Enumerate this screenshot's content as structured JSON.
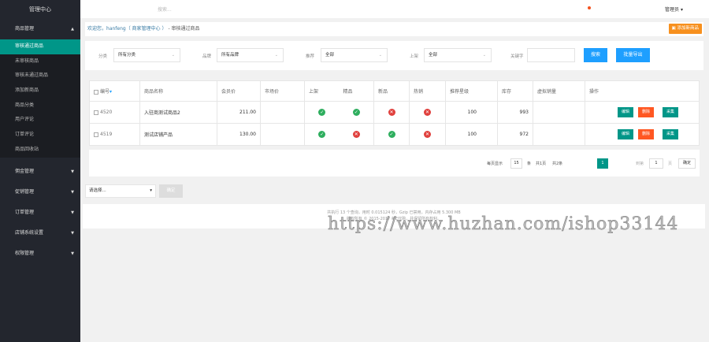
{
  "sidebar": {
    "title": "管理中心",
    "groups": [
      {
        "label": "商品管理",
        "items": [
          "审核通过商品",
          "未审核商品",
          "审核未通过商品",
          "添加新商品",
          "商品分类",
          "用户评论",
          "订单评论",
          "商品回收站"
        ]
      },
      {
        "label": "佣金管理"
      },
      {
        "label": "促销管理"
      },
      {
        "label": "订单管理"
      },
      {
        "label": "店铺系统设置"
      },
      {
        "label": "权限管理"
      }
    ]
  },
  "header": {
    "search_placeholder": "搜索...",
    "user": "管理员"
  },
  "breadcrumb": {
    "welcome": "欢迎您，",
    "user": "hanfeng",
    "center": "（ 商家管理中心 ）",
    "current": " - 审核通过商品",
    "add_button": "添加新商品"
  },
  "filters": {
    "category_label": "分类",
    "category": "所有分类",
    "brand_label": "品牌",
    "brand": "所有品牌",
    "recommend_label": "推荐",
    "recommend": "全部",
    "onsale_label": "上架",
    "onsale": "全部",
    "keyword_label": "关键字",
    "keyword": "",
    "search": "搜索",
    "export": "批量导出"
  },
  "table": {
    "headers": [
      "编号",
      "商品名称",
      "会员价",
      "市场价",
      "上架",
      "精品",
      "新品",
      "热销",
      "推荐星级",
      "库存",
      "虚拟销量",
      "操作"
    ],
    "rows": [
      {
        "id": "4520",
        "name": "入驻商测试商品2",
        "price": "211.00",
        "market": "",
        "onsale": true,
        "best": true,
        "new": false,
        "hot": false,
        "star": "100",
        "stock": "993",
        "virtual": ""
      },
      {
        "id": "4519",
        "name": "测试店铺产品",
        "price": "130.00",
        "market": "",
        "onsale": true,
        "best": false,
        "new": true,
        "hot": false,
        "star": "100",
        "stock": "972",
        "virtual": ""
      }
    ],
    "actions": [
      "编辑",
      "删除",
      "采集"
    ]
  },
  "pagination": {
    "per_page_label": "每页显示",
    "per_page": "15",
    "unit": "条",
    "total_pages": "共1页",
    "total_items": "共2条",
    "current": "1",
    "goto_label": "到第",
    "goto": "1",
    "page_unit": "页",
    "confirm": "确定"
  },
  "bulk": {
    "select": "请选择...",
    "confirm": "确定"
  },
  "footer": {
    "line1": "共执行 13 个查询，用时 0.015124 秒，Gzip 已禁用，内存占用 5.300 MB",
    "line2": "版权所有 © 2015-2017 每E代购，并保留所有权利。"
  },
  "watermark": "https://www.huzhan.com/ishop33144"
}
